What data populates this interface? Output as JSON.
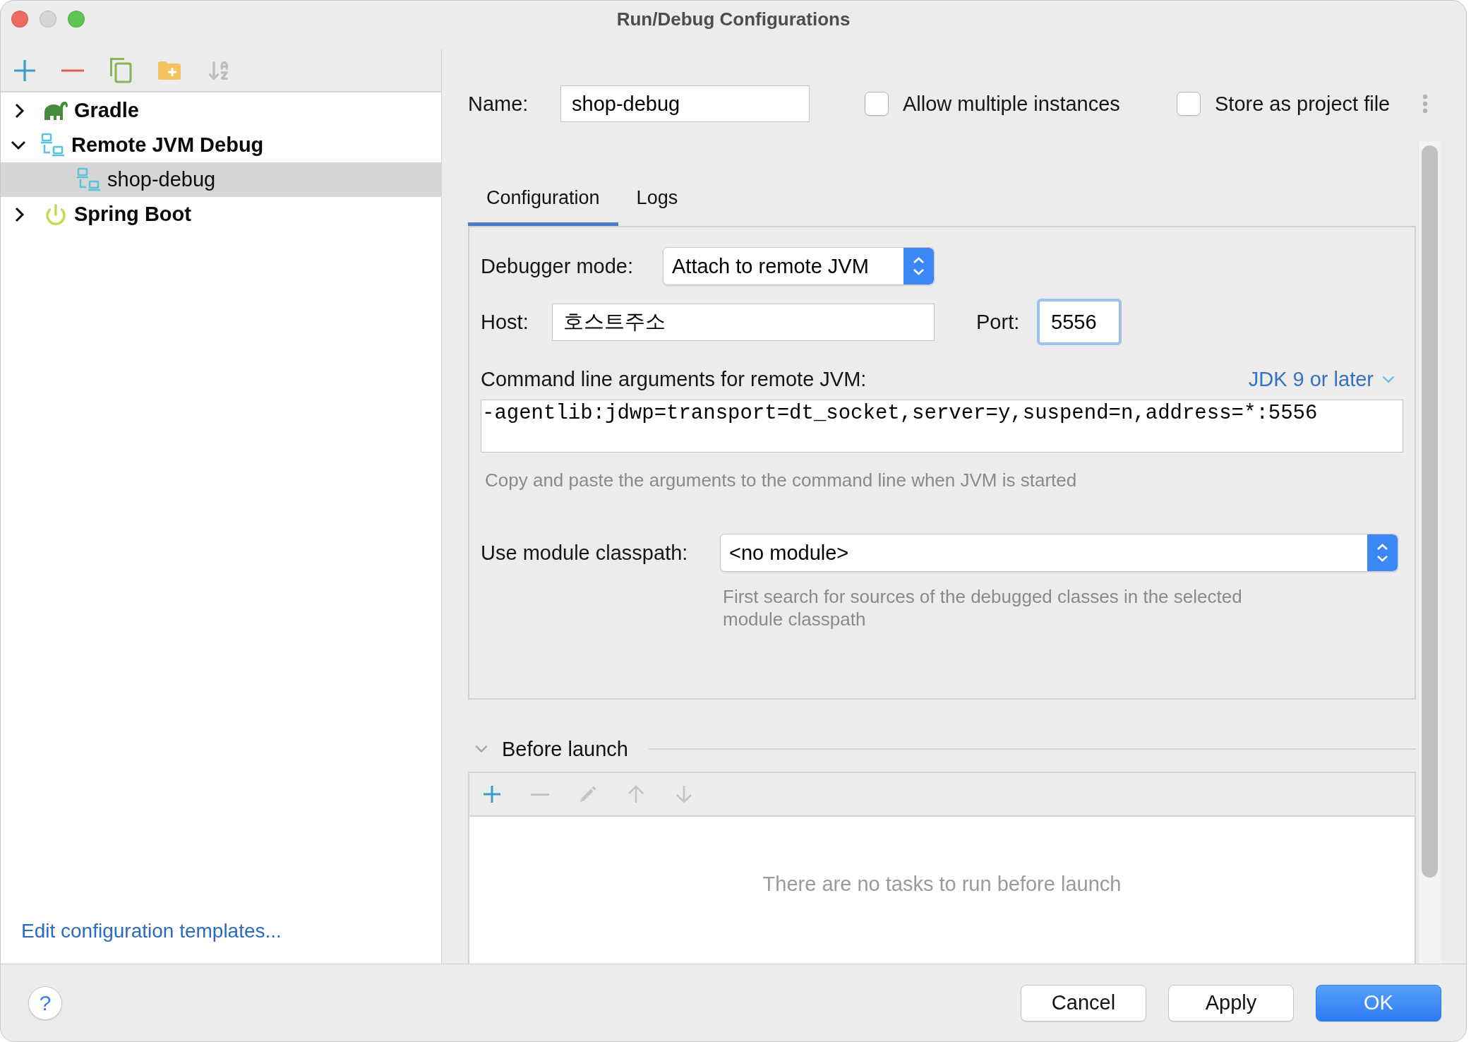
{
  "window": {
    "title": "Run/Debug Configurations"
  },
  "sidebar": {
    "tree": [
      {
        "label": "Gradle",
        "kind": "gradle",
        "expanded": false,
        "selected": false
      },
      {
        "label": "Remote JVM Debug",
        "kind": "remote_debug",
        "expanded": true,
        "selected": false,
        "children": [
          {
            "label": "shop-debug",
            "kind": "remote_debug",
            "selected": true
          }
        ]
      },
      {
        "label": "Spring Boot",
        "kind": "spring_boot",
        "expanded": false,
        "selected": false
      }
    ],
    "link": "Edit configuration templates..."
  },
  "name": {
    "label": "Name:",
    "value": "shop-debug"
  },
  "options": [
    {
      "label": "Allow multiple instances",
      "checked": false
    },
    {
      "label": "Store as project file",
      "checked": false
    }
  ],
  "tabs": [
    {
      "label": "Configuration",
      "selected": true
    },
    {
      "label": "Logs",
      "selected": false
    }
  ],
  "configuration": {
    "debugger_mode": {
      "label": "Debugger mode:",
      "value": "Attach to remote JVM"
    },
    "host": {
      "label": "Host:",
      "value": "호스트주소"
    },
    "port": {
      "label": "Port:",
      "value": "5556",
      "focused": true
    },
    "command_line": {
      "label": "Command line arguments for remote JVM:",
      "jdk_selector": "JDK 9 or later",
      "value": "-agentlib:jdwp=transport=dt_socket,server=y,suspend=n,address=*:5556",
      "hint": "Copy and paste the arguments to the command line when JVM is started"
    },
    "module_classpath": {
      "label": "Use module classpath:",
      "value": "<no module>",
      "hint": "First search for sources of the debugged classes in the selected module classpath"
    }
  },
  "before_launch": {
    "title": "Before launch",
    "expanded": true,
    "toolbar": [
      {
        "kind": "add",
        "disabled": false
      },
      {
        "kind": "remove",
        "disabled": true
      },
      {
        "kind": "edit",
        "disabled": true
      },
      {
        "kind": "move_up",
        "disabled": true
      },
      {
        "kind": "move_down",
        "disabled": true
      }
    ],
    "empty_text": "There are no tasks to run before launch"
  },
  "help_button": "?",
  "buttons": [
    {
      "label": "Cancel",
      "kind": "default"
    },
    {
      "label": "Apply",
      "kind": "default"
    },
    {
      "label": "OK",
      "kind": "primary"
    }
  ]
}
